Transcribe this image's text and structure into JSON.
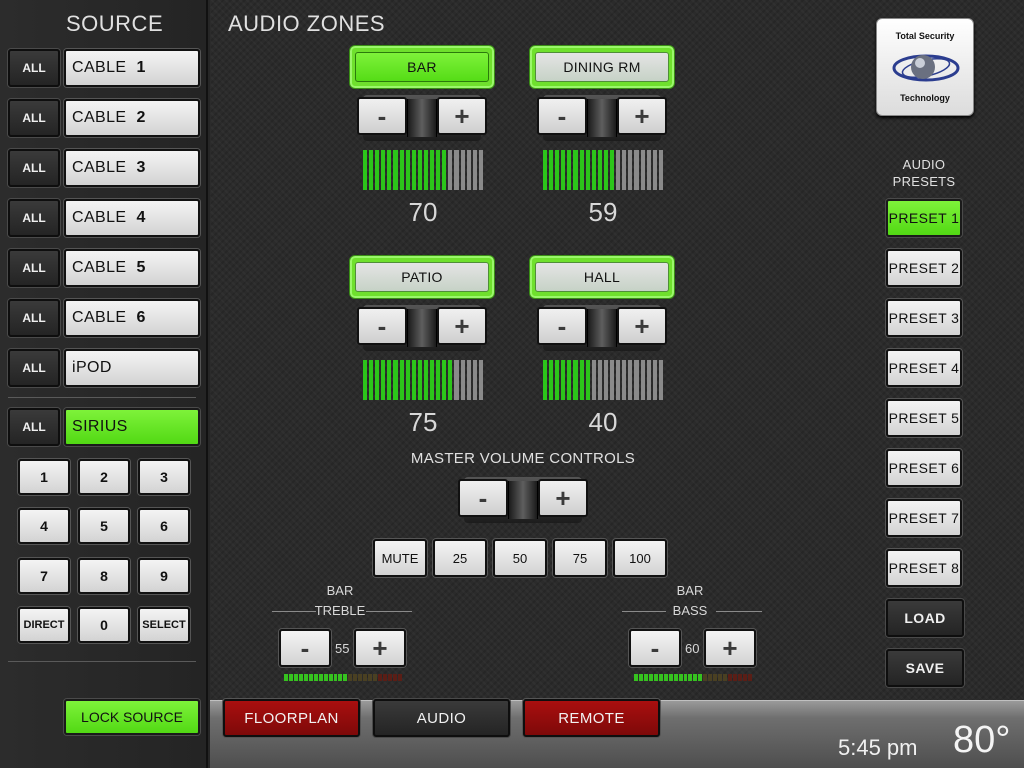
{
  "source": {
    "title": "SOURCE",
    "all_label": "ALL",
    "items": [
      {
        "name": "CABLE",
        "num": "1",
        "selected": false
      },
      {
        "name": "CABLE",
        "num": "2",
        "selected": false
      },
      {
        "name": "CABLE",
        "num": "3",
        "selected": false
      },
      {
        "name": "CABLE",
        "num": "4",
        "selected": false
      },
      {
        "name": "CABLE",
        "num": "5",
        "selected": false
      },
      {
        "name": "CABLE",
        "num": "6",
        "selected": false
      },
      {
        "name": "iPOD",
        "num": "",
        "selected": false
      },
      {
        "name": "SIRIUS",
        "num": "",
        "selected": true
      }
    ],
    "keypad": [
      "1",
      "2",
      "3",
      "4",
      "5",
      "6",
      "7",
      "8",
      "9",
      "DIRECT",
      "0",
      "SELECT"
    ],
    "lock_label": "LOCK SOURCE"
  },
  "zones": {
    "title": "AUDIO ZONES",
    "items": [
      {
        "name": "BAR",
        "volume": "70",
        "level": 0.7,
        "active": true
      },
      {
        "name": "DINING RM",
        "volume": "59",
        "level": 0.59,
        "active": false
      },
      {
        "name": "PATIO",
        "volume": "75",
        "level": 0.75,
        "active": false
      },
      {
        "name": "HALL",
        "volume": "40",
        "level": 0.4,
        "active": false
      }
    ],
    "minus": "-",
    "plus": "+"
  },
  "master": {
    "title": "MASTER VOLUME CONTROLS",
    "presets": [
      "MUTE",
      "25",
      "50",
      "75",
      "100"
    ]
  },
  "tone": {
    "treble": {
      "zone": "BAR",
      "label": "TREBLE",
      "value": "55",
      "level": 0.55
    },
    "bass": {
      "zone": "BAR",
      "label": "BASS",
      "value": "60",
      "level": 0.6
    }
  },
  "logo": {
    "line1": "Total Security",
    "line2": "Technology"
  },
  "audio_presets": {
    "title_line1": "AUDIO",
    "title_line2": "PRESETS",
    "items": [
      "PRESET 1",
      "PRESET 2",
      "PRESET 3",
      "PRESET 4",
      "PRESET 5",
      "PRESET 6",
      "PRESET 7",
      "PRESET 8"
    ],
    "active_index": 0,
    "load": "LOAD",
    "save": "SAVE"
  },
  "nav": {
    "floorplan": "FLOORPLAN",
    "audio": "AUDIO",
    "remote": "REMOTE"
  },
  "status": {
    "time": "5:45 pm",
    "temperature": "80°"
  },
  "colors": {
    "accent_green": "#5fe41f",
    "nav_red": "#8f0c0c",
    "meter_green": "#2cc51a"
  }
}
